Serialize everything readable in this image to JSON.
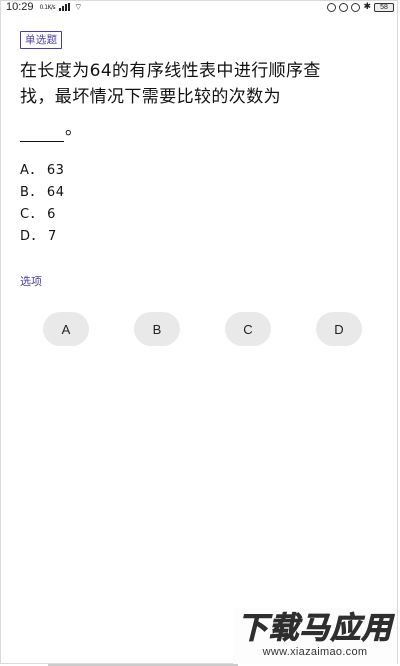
{
  "status_bar": {
    "time": "10:29",
    "net_speed": "0.1K/s",
    "battery": "58"
  },
  "question": {
    "type_tag": "单选题",
    "line1": "在长度为64的有序线性表中进行顺序查",
    "line2": "找，最坏情况下需要比较的次数为",
    "line3_end": "。"
  },
  "options": [
    {
      "letter": "A．",
      "text": "63"
    },
    {
      "letter": "B．",
      "text": "64"
    },
    {
      "letter": "C．",
      "text": "6"
    },
    {
      "letter": "D．",
      "text": "7"
    }
  ],
  "select_label": "选项",
  "answers": [
    "A",
    "B",
    "C",
    "D"
  ],
  "watermark": {
    "main": "下载马应用",
    "url": "www.xiazaimao.com"
  },
  "colors": {
    "accent": "#4a3f9b",
    "button_bg": "#e9e9e9"
  }
}
